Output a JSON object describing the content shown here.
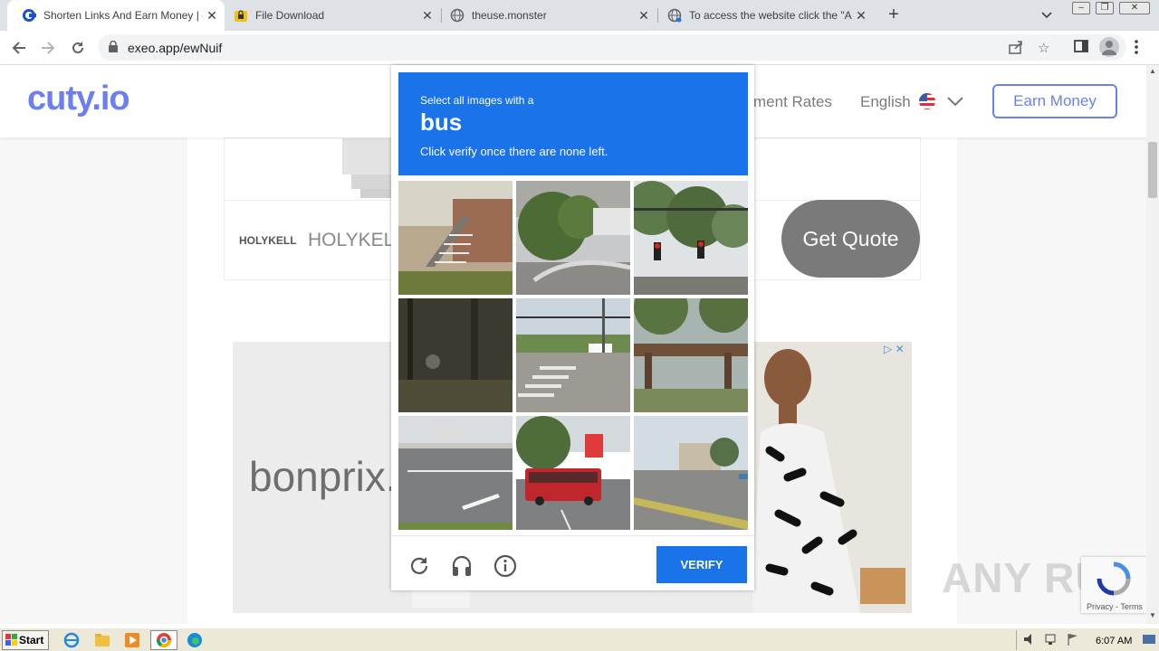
{
  "browser": {
    "tabs": [
      {
        "title": "Shorten Links And Earn Money | cuty",
        "active": true,
        "favicon": "cuty-c-icon"
      },
      {
        "title": "File Download",
        "active": false,
        "favicon": "lock-folder-icon"
      },
      {
        "title": "theuse.monster",
        "active": false,
        "favicon": "globe-icon"
      },
      {
        "title": "To access the website click the \"Allow",
        "active": false,
        "favicon": "globe-icon"
      }
    ],
    "new_tab": "+",
    "url": "exeo.app/ewNuif"
  },
  "site": {
    "logo": "cuty.io",
    "nav_rates": "ment Rates",
    "language": "English",
    "earn_button": "Earn Money"
  },
  "ads": {
    "brand_logo": "HOLYKELL",
    "brand_text": "HOLYKELL",
    "cta": "Get Quote",
    "bonprix": "bonprix.",
    "privacy": "Privacy - Terms",
    "watermark": "ANY RUN"
  },
  "captcha": {
    "line1": "Select all images with a",
    "target": "bus",
    "line3": "Click verify once there are none left.",
    "verify_label": "VERIFY",
    "tiles": [
      {
        "name": "house-stairs"
      },
      {
        "name": "street-corner-tree"
      },
      {
        "name": "traffic-lights"
      },
      {
        "name": "dark-woods"
      },
      {
        "name": "intersection-crosswalk"
      },
      {
        "name": "wooden-shelter"
      },
      {
        "name": "highway-truck"
      },
      {
        "name": "red-bus"
      },
      {
        "name": "road-building"
      }
    ]
  },
  "taskbar": {
    "start": "Start",
    "clock": "6:07 AM"
  }
}
